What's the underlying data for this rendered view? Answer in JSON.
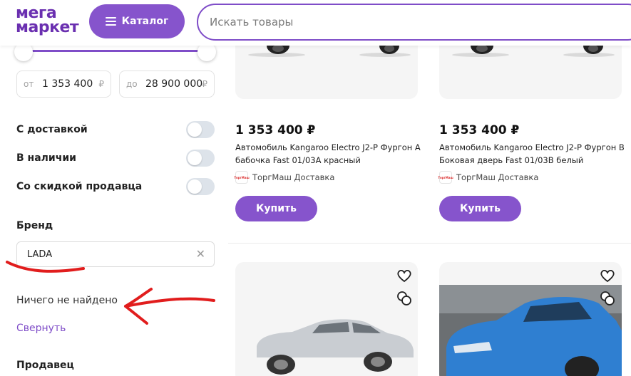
{
  "header": {
    "logo_line1": "мега",
    "logo_line2": "маркет",
    "catalog_label": "Каталог",
    "search_placeholder": "Искать товары"
  },
  "filters": {
    "price_from_prefix": "от",
    "price_from": "1 353 400",
    "price_to_prefix": "до",
    "price_to": "28 900 000",
    "currency": "₽",
    "toggles": [
      {
        "label": "С доставкой",
        "on": false
      },
      {
        "label": "В наличии",
        "on": false
      },
      {
        "label": "Со скидкой продавца",
        "on": false
      }
    ],
    "brand_title": "Бренд",
    "brand_value": "LADA",
    "nothing_found": "Ничего не найдено",
    "collapse_label": "Свернуть",
    "seller_title": "Продавец"
  },
  "products": [
    {
      "price": "1 353 400 ₽",
      "title": "Автомобиль Kangaroo Electro J2-P Фургон А бабочка Fast 01/03А красный",
      "seller_logo": "ТоргМаш",
      "seller": "ТоргМаш Доставка",
      "buy_label": "Купить"
    },
    {
      "price": "1 353 400 ₽",
      "title": "Автомобиль Kangaroo Electro J2-P Фургон В Боковая дверь Fast 01/03В белый",
      "seller_logo": "ТоргМаш",
      "seller": "ТоргМаш Доставка",
      "buy_label": "Купить"
    }
  ],
  "colors": {
    "brand_purple": "#8654cc",
    "annotation_red": "#e11d1d"
  }
}
